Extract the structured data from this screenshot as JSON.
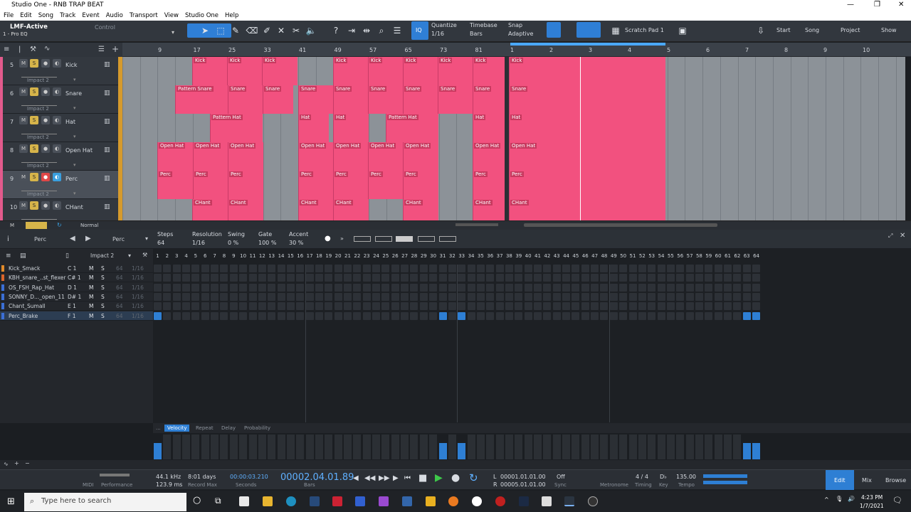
{
  "window": {
    "title": "Studio One - RNB TRAP BEAT",
    "controls": [
      "—",
      "❐",
      "✕"
    ]
  },
  "menu": [
    "File",
    "Edit",
    "Song",
    "Track",
    "Event",
    "Audio",
    "Transport",
    "View",
    "Studio One",
    "Help"
  ],
  "toolbar": {
    "device": "LMF-Active",
    "device_sub": "1 - Pro EQ",
    "control": "Control",
    "quantize_label": "Quantize",
    "quantize_value": "1/16",
    "timebase_label": "Timebase",
    "timebase_value": "Bars",
    "snap_label": "Snap",
    "snap_value": "Adaptive",
    "scratch": "Scratch Pad 1",
    "nav": [
      "Start",
      "Song",
      "Project",
      "Show"
    ]
  },
  "tracks": [
    {
      "num": "5",
      "name": "Kick",
      "inst": "Impact 2"
    },
    {
      "num": "6",
      "name": "Snare",
      "inst": "Impact 2"
    },
    {
      "num": "7",
      "name": "Hat",
      "inst": "Impact 2"
    },
    {
      "num": "8",
      "name": "Open Hat",
      "inst": "Impact 2"
    },
    {
      "num": "9",
      "name": "Perc",
      "inst": "Impact 2"
    },
    {
      "num": "10",
      "name": "CHant",
      "inst": "Impact 2"
    }
  ],
  "ruler_left": [
    "9",
    "17",
    "25",
    "33",
    "41",
    "49",
    "57",
    "65",
    "73",
    "81"
  ],
  "ruler_right": [
    "1",
    "2",
    "3",
    "4",
    "5",
    "6",
    "7",
    "8",
    "9",
    "10"
  ],
  "clips": {
    "kick": [
      "Kick",
      "Kick",
      "Kick",
      "Kick",
      "Kick",
      "Kick",
      "Kick",
      "Kick",
      "Kick"
    ],
    "snare": [
      "Pattern Snare",
      "Snare",
      "Snare",
      "Snare",
      "Snare",
      "Snare",
      "Snare",
      "Snare",
      "Snare",
      "Snare"
    ],
    "hat": [
      "Pattern Hat",
      "Hat",
      "Hat",
      "Pattern Hat",
      "Hat",
      "Hat"
    ],
    "openhat": [
      "Open Hat",
      "Open Hat",
      "Open Hat",
      "Open Hat",
      "Open Hat",
      "Open Hat",
      "Open Hat",
      "Open Hat",
      "Open Hat"
    ],
    "perc": [
      "Perc",
      "Perc",
      "Perc",
      "Perc",
      "Perc",
      "Perc",
      "Perc",
      "Perc",
      "Perc"
    ],
    "chant": [
      "CHant",
      "CHant",
      "CHant",
      "CHant",
      "CHant",
      "CHant",
      "CHant"
    ]
  },
  "arrange_footer": {
    "mode": "Normal"
  },
  "editor": {
    "instrument": "Perc",
    "pattern": "Perc",
    "steps_label": "Steps",
    "steps": "64",
    "resolution_label": "Resolution",
    "resolution": "1/16",
    "swing_label": "Swing",
    "swing": "0 %",
    "gate_label": "Gate",
    "gate": "100 %",
    "accent_label": "Accent",
    "accent": "30 %",
    "kit": "Impact 2"
  },
  "instruments": [
    {
      "name": "Kick_Smack",
      "key": "C 1",
      "color": "#e08a2a"
    },
    {
      "name": "KBH_snare_..st_flexer",
      "key": "C# 1",
      "color": "#d9652b"
    },
    {
      "name": "OS_FSH_Rap_Hat",
      "key": "D 1",
      "color": "#3b6fd6"
    },
    {
      "name": "SONNY_D..._open_11",
      "key": "D# 1",
      "color": "#3b6fd6"
    },
    {
      "name": "Chant_Sumall",
      "key": "E 1",
      "color": "#3b6fd6"
    },
    {
      "name": "Perc_Brake",
      "key": "F 1",
      "color": "#3b6fd6"
    }
  ],
  "inst_cols": {
    "m": "M",
    "s": "S",
    "vel": "64",
    "res": "1/16"
  },
  "perc_steps_on": [
    1,
    31,
    33,
    63,
    64
  ],
  "vel_tabs": [
    "...",
    "Velocity",
    "Repeat",
    "Delay",
    "Probability"
  ],
  "transport": {
    "midi": "MIDI",
    "perf": "Performance",
    "rate": "44.1 kHz",
    "latency": "123.9 ms",
    "rec_days": "8:01 days",
    "rec_max": "Record Max",
    "seconds": "00:00:03.210",
    "seconds_label": "Seconds",
    "bars": "00002.04.01.89",
    "bars_label": "Bars",
    "L": "00001.01.01.00",
    "R": "00005.01.01.00",
    "sync": "Off",
    "sync_label": "Sync",
    "metronome": "Metronome",
    "timing_val": "4 / 4",
    "timing": "Timing",
    "key": "Key",
    "tempo_val": "135.00",
    "tempo": "Tempo",
    "tabs": [
      "Edit",
      "Mix",
      "Browse"
    ]
  },
  "taskbar": {
    "search": "Type here to search",
    "time": "4:23 PM",
    "date": "1/7/2021"
  }
}
